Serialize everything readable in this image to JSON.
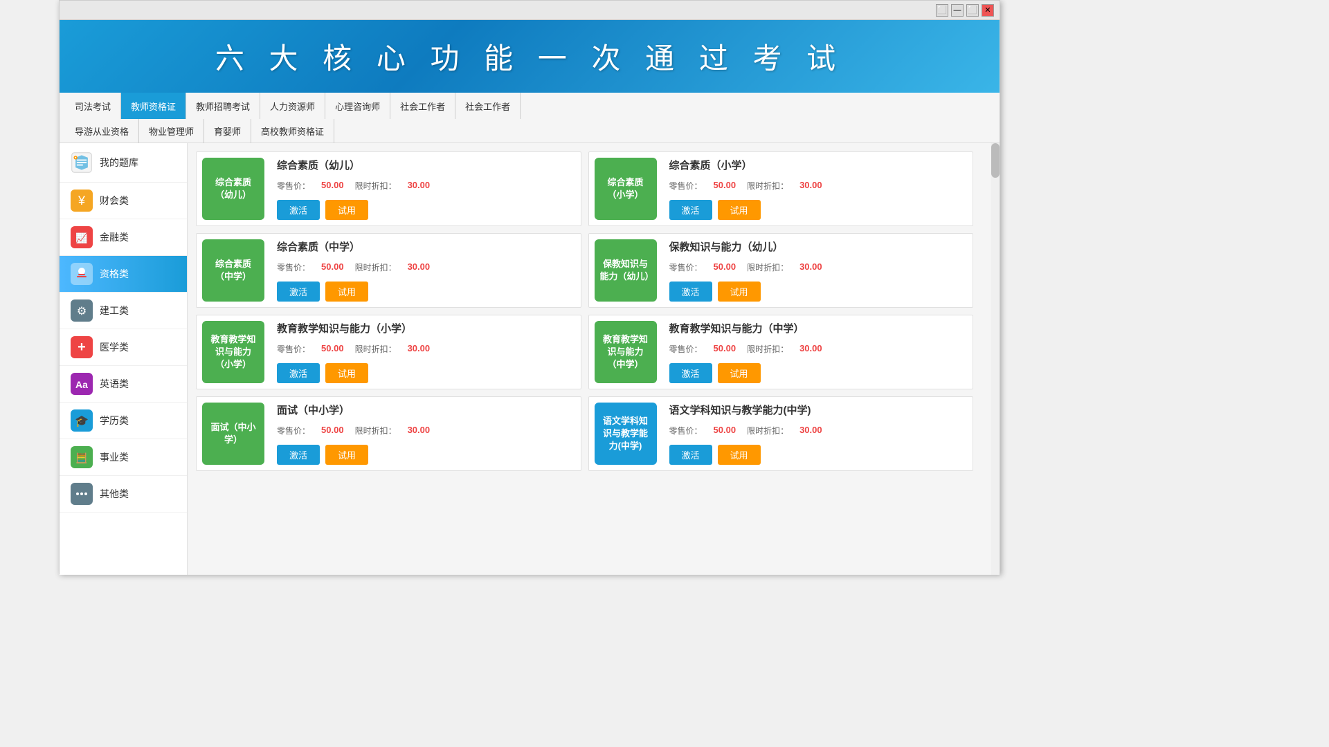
{
  "window": {
    "titlebar": {
      "restore_label": "⬜",
      "minimize_label": "—",
      "maximize_label": "⬜",
      "close_label": "✕"
    }
  },
  "header": {
    "title": "六 大 核 心 功 能  一 次 通 过 考 试"
  },
  "sidebar": {
    "header_label": "我的题库",
    "items": [
      {
        "id": "cj",
        "label": "财会类",
        "icon_char": "💰"
      },
      {
        "id": "jr",
        "label": "金融类",
        "icon_char": "📈"
      },
      {
        "id": "zg",
        "label": "资格类",
        "icon_char": "🔴",
        "active": true
      },
      {
        "id": "jg",
        "label": "建工类",
        "icon_char": "⚙"
      },
      {
        "id": "yx",
        "label": "医学类",
        "icon_char": "➕"
      },
      {
        "id": "yy",
        "label": "英语类",
        "icon_char": "A"
      },
      {
        "id": "xl",
        "label": "学历类",
        "icon_char": "🎓"
      },
      {
        "id": "sy",
        "label": "事业类",
        "icon_char": "🧮"
      },
      {
        "id": "qt",
        "label": "其他类",
        "icon_char": "⋯"
      }
    ]
  },
  "nav": {
    "row1": [
      {
        "id": "sifa",
        "label": "司法考试",
        "active": false
      },
      {
        "id": "jszy",
        "label": "教师资格证",
        "active": true
      },
      {
        "id": "jszp",
        "label": "教师招聘考试",
        "active": false
      },
      {
        "id": "rlzy",
        "label": "人力资源师",
        "active": false
      },
      {
        "id": "xlzx",
        "label": "心理咨询师",
        "active": false
      },
      {
        "id": "shgz",
        "label": "社会工作者",
        "active": false
      },
      {
        "id": "shgz2",
        "label": "社会工作者",
        "active": false
      }
    ],
    "row2": [
      {
        "id": "dyzy",
        "label": "导游从业资格",
        "active": false
      },
      {
        "id": "wygl",
        "label": "物业管理师",
        "active": false
      },
      {
        "id": "ys",
        "label": "育婴师",
        "active": false
      },
      {
        "id": "gxjs",
        "label": "高校教师资格证",
        "active": false
      }
    ]
  },
  "products": [
    {
      "id": "p1",
      "badge_text": "综合素质（幼儿）",
      "badge_color": "green",
      "name": "综合素质（幼儿）",
      "retail_price": "50.00",
      "discount_price": "30.00",
      "btn_activate": "激活",
      "btn_trial": "试用"
    },
    {
      "id": "p2",
      "badge_text": "综合素质（小学）",
      "badge_color": "green",
      "name": "综合素质（小学）",
      "retail_price": "50.00",
      "discount_price": "30.00",
      "btn_activate": "激活",
      "btn_trial": "试用"
    },
    {
      "id": "p3",
      "badge_text": "综合素质（中学）",
      "badge_color": "green",
      "name": "综合素质（中学）",
      "retail_price": "50.00",
      "discount_price": "30.00",
      "btn_activate": "激活",
      "btn_trial": "试用"
    },
    {
      "id": "p4",
      "badge_text": "保教知识与能力（幼儿）",
      "badge_color": "green",
      "name": "保教知识与能力（幼儿）",
      "retail_price": "50.00",
      "discount_price": "30.00",
      "btn_activate": "激活",
      "btn_trial": "试用"
    },
    {
      "id": "p5",
      "badge_text": "教育教学知识与能力（小学）",
      "badge_color": "green",
      "name": "教育教学知识与能力（小学）",
      "retail_price": "50.00",
      "discount_price": "30.00",
      "btn_activate": "激活",
      "btn_trial": "试用"
    },
    {
      "id": "p6",
      "badge_text": "教育教学知识与能力（中学）",
      "badge_color": "green",
      "name": "教育教学知识与能力（中学）",
      "retail_price": "50.00",
      "discount_price": "30.00",
      "btn_activate": "激活",
      "btn_trial": "试用"
    },
    {
      "id": "p7",
      "badge_text": "面试（中小学）",
      "badge_color": "green",
      "name": "面试（中小学）",
      "retail_price": "50.00",
      "discount_price": "30.00",
      "btn_activate": "激活",
      "btn_trial": "试用"
    },
    {
      "id": "p8",
      "badge_text": "语文学科知识与教学能力(中学)",
      "badge_color": "blue",
      "name": "语文学科知识与教学能力(中学)",
      "retail_price": "50.00",
      "discount_price": "30.00",
      "btn_activate": "激活",
      "btn_trial": "试用"
    }
  ],
  "labels": {
    "retail": "零售价：",
    "discount": "限时折扣："
  }
}
